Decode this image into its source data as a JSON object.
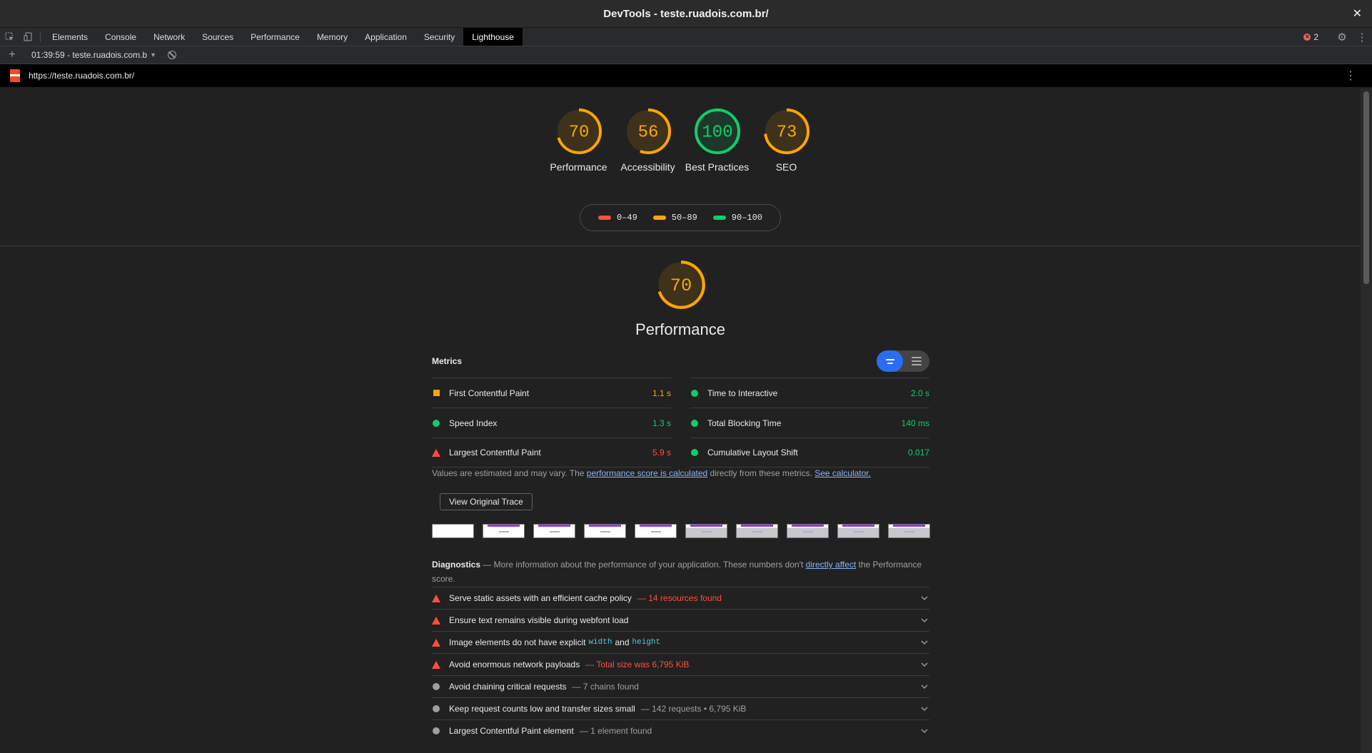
{
  "window": {
    "title": "DevTools - teste.ruadois.com.br/",
    "close": "✕"
  },
  "tabs": [
    "Elements",
    "Console",
    "Network",
    "Sources",
    "Performance",
    "Memory",
    "Application",
    "Security",
    "Lighthouse"
  ],
  "active_tab": "Lighthouse",
  "errors": {
    "count": "2"
  },
  "report_bar": {
    "selected_report": "01:39:59 - teste.ruadois.com.b"
  },
  "url_bar": {
    "url": "https://teste.ruadois.com.br/"
  },
  "categories": [
    {
      "score": 70,
      "label": "Performance",
      "color": "#ffa400"
    },
    {
      "score": 56,
      "label": "Accessibility",
      "color": "#ffa400"
    },
    {
      "score": 100,
      "label": "Best Practices",
      "color": "#0cce6b"
    },
    {
      "score": 73,
      "label": "SEO",
      "color": "#ffa400"
    }
  ],
  "legend": [
    {
      "range": "0–49",
      "color": "#ff4e42"
    },
    {
      "range": "50–89",
      "color": "#ffa400"
    },
    {
      "range": "90–100",
      "color": "#0cce6b"
    }
  ],
  "performance": {
    "score": 70,
    "title": "Performance",
    "metrics_heading": "Metrics",
    "metrics": [
      {
        "name": "First Contentful Paint",
        "value": "1.1 s",
        "rating": "average"
      },
      {
        "name": "Time to Interactive",
        "value": "2.0 s",
        "rating": "pass"
      },
      {
        "name": "Speed Index",
        "value": "1.3 s",
        "rating": "pass"
      },
      {
        "name": "Total Blocking Time",
        "value": "140 ms",
        "rating": "pass"
      },
      {
        "name": "Largest Contentful Paint",
        "value": "5.9 s",
        "rating": "fail"
      },
      {
        "name": "Cumulative Layout Shift",
        "value": "0.017",
        "rating": "pass"
      }
    ],
    "note": {
      "prefix": "Values are estimated and may vary. The ",
      "link1": "performance score is calculated",
      "middle": " directly from these metrics. ",
      "link2": "See calculator."
    },
    "trace_button": "View Original Trace",
    "diagnostics": {
      "heading": "Diagnostics",
      "desc_prefix": " — More information about the performance of your application. These numbers don't ",
      "desc_link": "directly affect",
      "desc_suffix": " the Performance score."
    },
    "audits": [
      {
        "title": "Serve static assets with an efficient cache policy",
        "extra": "— 14 resources found",
        "rating": "fail"
      },
      {
        "title": "Ensure text remains visible during webfont load",
        "extra": "",
        "rating": "fail"
      },
      {
        "title": "Image elements do not have explicit",
        "code1": "width",
        "and": "and",
        "code2": "height",
        "rating": "fail"
      },
      {
        "title": "Avoid enormous network payloads",
        "extra": "— Total size was 6,795 KiB",
        "rating": "fail"
      },
      {
        "title": "Avoid chaining critical requests",
        "extra": "— 7 chains found",
        "rating": "info"
      },
      {
        "title": "Keep request counts low and transfer sizes small",
        "extra": "— 142 requests • 6,795 KiB",
        "rating": "info"
      },
      {
        "title": "Largest Contentful Paint element",
        "extra": "— 1 element found",
        "rating": "info"
      }
    ]
  }
}
